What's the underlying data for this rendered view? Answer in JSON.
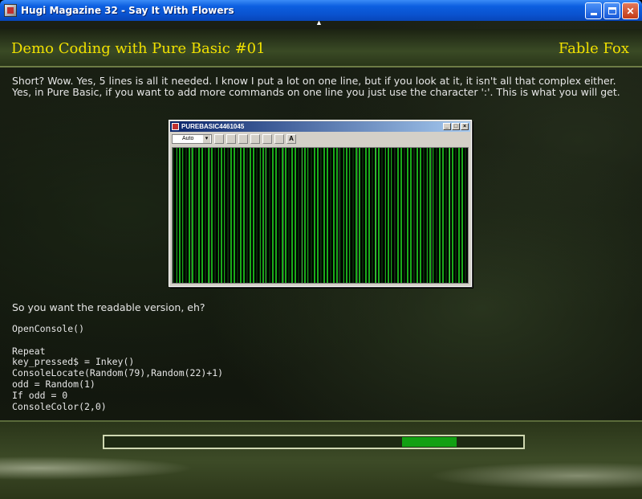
{
  "window": {
    "title": "Hugi Magazine 32 - Say It With Flowers",
    "min_label": "",
    "max_label": "",
    "close_label": "✕"
  },
  "header": {
    "title": "Demo Coding with Pure Basic #01",
    "author": "Fable Fox"
  },
  "article": {
    "intro": "Short? Wow. Yes, 5 lines is all it needed. I know I put a lot on one line, but if you look at it, it isn't all that complex either. Yes, in Pure Basic, if you want to add more commands on one line you just use the character ':'. This is what you will get.",
    "after_image": "So you want the readable version, eh?",
    "code": "OpenConsole()\n\nRepeat\nkey_pressed$ = Inkey()\nConsoleLocate(Random(79),Random(22)+1)\nodd = Random(1)\nIf odd = 0\nConsoleColor(2,0)"
  },
  "screenshot_window": {
    "title": "PUREBASIC4461045",
    "font_select": "Auto",
    "font_tool_label": "A",
    "min_label": "_",
    "max_label": "□",
    "close_label": "×"
  },
  "scroll": {
    "up_arrow": "▲"
  },
  "progress": {
    "start_fraction": 0.71,
    "end_fraction": 0.84,
    "fill_color": "#12a012"
  }
}
